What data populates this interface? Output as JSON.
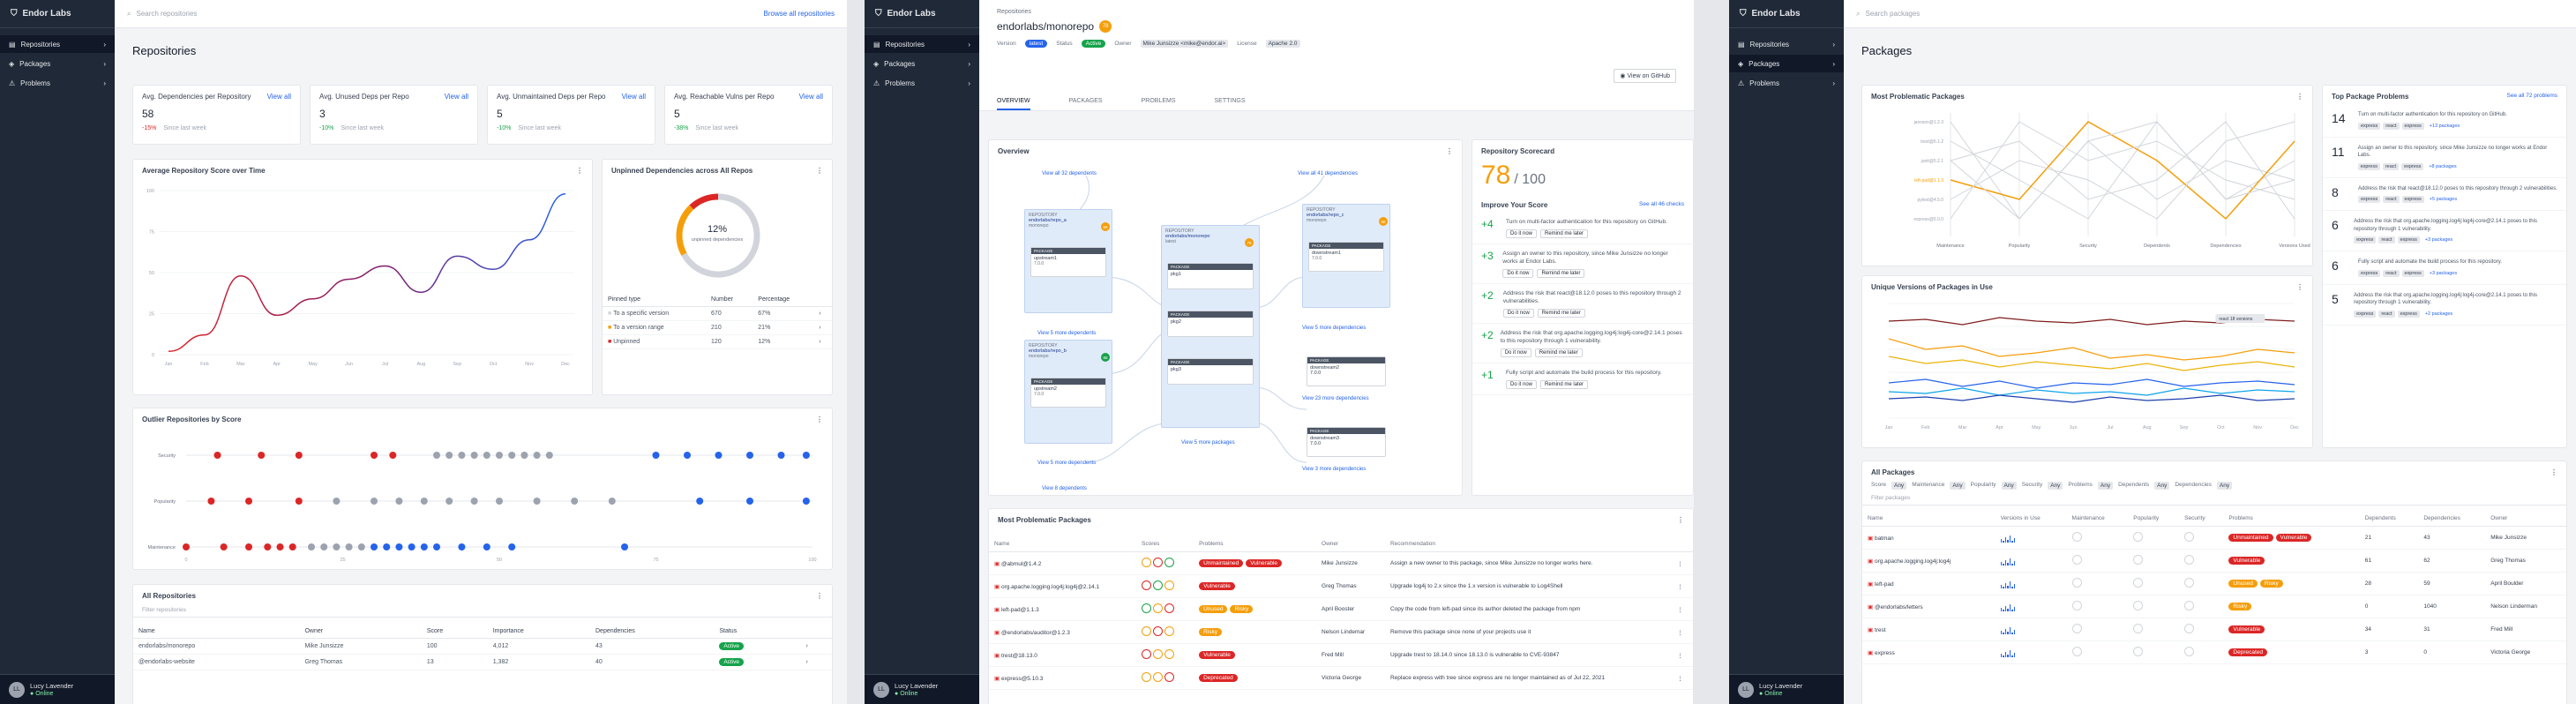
{
  "brand": "Endor Labs",
  "user": {
    "name": "Lucy Lavender",
    "status": "Online",
    "initials": "LL"
  },
  "nav": [
    "Repositories",
    "Packages",
    "Problems"
  ],
  "s1": {
    "search_placeholder": "Search repositories",
    "browse_link": "Browse all repositories",
    "title": "Repositories",
    "kpis": [
      {
        "title": "Avg. Dependencies per Repository",
        "link": "View all",
        "value": "58",
        "delta": "-15%",
        "since": "Since last week",
        "dir": "down"
      },
      {
        "title": "Avg. Unused Deps per Repo",
        "link": "View all",
        "value": "3",
        "delta": "-10%",
        "since": "Since last week",
        "dir": "up"
      },
      {
        "title": "Avg. Unmaintained Deps per Repo",
        "link": "View all",
        "value": "5",
        "delta": "-10%",
        "since": "Since last week",
        "dir": "up"
      },
      {
        "title": "Avg. Reachable Vulns per Repo",
        "link": "View all",
        "value": "5",
        "delta": "-38%",
        "since": "Since last week",
        "dir": "up"
      }
    ],
    "score_chart": {
      "title": "Average Repository Score over Time"
    },
    "unpinned": {
      "title": "Unpinned Dependencies across All Repos",
      "pct": "12%",
      "sub": "unpinned dependencies",
      "headers": [
        "Pinned type",
        "Number",
        "Percentage"
      ],
      "rows": [
        [
          "To a specific version",
          "670",
          "67%"
        ],
        [
          "To a version range",
          "210",
          "21%"
        ],
        [
          "Unpinned",
          "120",
          "12%"
        ]
      ]
    },
    "outlier": {
      "title": "Outlier Repositories by Score",
      "rows": [
        "Security",
        "Popularity",
        "Maintenance"
      ]
    },
    "all_repos": {
      "title": "All Repositories",
      "filter": "Filter repositories",
      "headers": [
        "Name",
        "Owner",
        "Score",
        "Importance",
        "Dependencies",
        "Status"
      ],
      "rows": [
        [
          "endorlabs/monorepo",
          "Mike Junsizze",
          "100",
          "4,012",
          "43",
          "Active"
        ],
        [
          "@endorlabs-website",
          "Greg Thomas",
          "13",
          "1,382",
          "40",
          "Active"
        ]
      ]
    }
  },
  "chart_data": [
    {
      "type": "line",
      "title": "Average Repository Score over Time",
      "categories": [
        "Jan",
        "Feb",
        "Mar",
        "Apr",
        "May",
        "Jun",
        "Jul",
        "Aug",
        "Sep",
        "Oct",
        "Nov",
        "Dec"
      ],
      "series": [
        {
          "values": [
            2,
            12,
            48,
            24,
            34,
            46,
            54,
            38,
            60,
            52,
            70,
            98
          ]
        }
      ],
      "ylim": [
        0,
        100
      ],
      "yticks": [
        "0",
        "25",
        "50",
        "75",
        "100"
      ]
    },
    {
      "type": "pie",
      "title": "Unpinned Dependencies across All Repos",
      "categories": [
        "To a specific version",
        "To a version range",
        "Unpinned"
      ],
      "values": [
        67,
        21,
        12
      ]
    },
    {
      "type": "scatter",
      "title": "Outlier Repositories by Score",
      "categories": [
        "Security",
        "Popularity",
        "Maintenance"
      ],
      "xticks": [
        "0",
        "25",
        "50",
        "75",
        "100"
      ],
      "xlim": [
        0,
        100
      ]
    }
  ],
  "s2": {
    "crumb": "Repositories",
    "title": "endorlabs/monorepo",
    "score": "78",
    "meta": {
      "version_label": "Version",
      "version": "latest",
      "status_label": "Status",
      "status": "Active",
      "owner_label": "Owner",
      "owner": "Mike Junsizze <mike@endor.ai>",
      "license_label": "License",
      "license": "Apache 2.0"
    },
    "github_btn": "View on GitHub",
    "tabs": [
      "OVERVIEW",
      "PACKAGES",
      "PROBLEMS",
      "SETTINGS"
    ],
    "overview_title": "Overview",
    "view_dependents": "View all 32 dependents",
    "view_deps": "View all 41 dependencies",
    "view_more_deps": "View 5 more dependents",
    "view_8": "View 8 dependents",
    "view_more_packages": "View 5 more packages",
    "view_more_deps2": "View 5 more dependencies",
    "view_23": "View 23 more dependencies",
    "view_3": "View 3 more dependencies",
    "scorecard": {
      "title": "Repository Scorecard",
      "score": "78",
      "out": "/ 100",
      "improve": "Improve Your Score",
      "see_all": "See all 46 checks",
      "items": [
        {
          "pts": "+4",
          "text": "Turn on multi-factor authentication for this repository on GitHub."
        },
        {
          "pts": "+3",
          "text": "Assign an owner to this repository, since Mike Junsizze no longer works at Endor Labs."
        },
        {
          "pts": "+2",
          "text": "Address the risk that react@18.12.0 poses to this repository through 2 vulnerabilities."
        },
        {
          "pts": "+2",
          "text": "Address the risk that org.apache.logging.log4j:log4j-core@2.14.1 poses to this repository through 1 vulnerability."
        },
        {
          "pts": "+1",
          "text": "Fully script and automate the build process for this repository."
        }
      ],
      "btn1": "Do it now",
      "btn2": "Remind me later"
    },
    "problematic": {
      "title": "Most Problematic Packages",
      "headers": [
        "Name",
        "Scores",
        "Problems",
        "Owner",
        "Recommendation"
      ],
      "rows": [
        [
          "@abmul@1.4.2",
          "Unmaintained",
          "Vulnerable",
          "Mike Junsizze",
          "Assign a new owner to this package, since Mike Junsizze no longer works here."
        ],
        [
          "org.apache.logging.log4j:log4j@2.14.1",
          "Vulnerable",
          "",
          "Greg Thomas",
          "Upgrade log4j to 2.x since the 1.x version is vulnerable to Log4Shell"
        ],
        [
          "left-pad@1.1.3",
          "Unused",
          "Risky",
          "April Booster",
          "Copy the code from left-pad since its author deleted the package from npm"
        ],
        [
          "@endorlabs/auditor@1.2.3",
          "Risky",
          "",
          "Nelson Lindemar",
          "Remove this package since none of your projects use it"
        ],
        [
          "trest@18.13.0",
          "Vulnerable",
          "",
          "Fred Mill",
          "Upgrade trest to 18.14.0 since 18.13.0 is vulnerable to CVE-93847"
        ],
        [
          "express@5.10.3",
          "Deprecated",
          "",
          "Victoria George",
          "Replace express with tree since express are no longer maintained as of Jul 22, 2021"
        ]
      ]
    }
  },
  "s3": {
    "search_placeholder": "Search packages",
    "title": "Packages",
    "mp_title": "Most Problematic Packages",
    "mp_axes": [
      "Maintenance",
      "Popularity",
      "Security",
      "Dependents",
      "Dependencies",
      "Versions Used"
    ],
    "mp_names": [
      "jansson@1.2.3",
      "trest@6.1.2",
      "junit@5.2.1",
      "left-pad@1.1.3",
      "pytest@4.5.0",
      "express@5.0.0"
    ],
    "uv_title": "Unique Versions of Packages in Use",
    "uv_tooltip": "react 18 versions",
    "uv_months": [
      "Jan",
      "Feb",
      "Mar",
      "Apr",
      "May",
      "Jun",
      "Jul",
      "Aug",
      "Sep",
      "Oct",
      "Nov",
      "Dec"
    ],
    "top_title": "Top Package Problems",
    "top_link": "See all 72 problems",
    "problems": [
      {
        "n": "14",
        "text": "Turn on multi-factor authentication for this repository on GitHub.",
        "more": "+13 packages"
      },
      {
        "n": "11",
        "text": "Assign an owner to this repository, since Mike Junsizze no longer works at Endor Labs.",
        "more": "+8 packages"
      },
      {
        "n": "8",
        "text": "Address the risk that react@18.12.0 poses to this repository through 2 vulnerabilities.",
        "more": "+5 packages"
      },
      {
        "n": "6",
        "text": "Address the risk that org.apache.logging.log4j:log4j-core@2.14.1 poses to this repository through 1 vulnerability.",
        "more": "+3 packages"
      },
      {
        "n": "6",
        "text": "Fully script and automate the build process for this repository.",
        "more": "+3 packages"
      },
      {
        "n": "5",
        "text": "Address the risk that org.apache.logging.log4j:log4j-core@2.14.1 poses to this repository through 1 vulnerability.",
        "more": "+2 packages"
      }
    ],
    "tags": [
      "express",
      "react",
      "express"
    ],
    "all_title": "All Packages",
    "filters": [
      "Score",
      "Maintenance",
      "Popularity",
      "Security",
      "Problems",
      "Dependents",
      "Dependencies"
    ],
    "filter_any": "Any",
    "filter_placeholder": "Filter packages",
    "headers": [
      "Name",
      "Versions in Use",
      "Maintenance",
      "Popularity",
      "Security",
      "Problems",
      "Dependents",
      "Dependencies",
      "Owner"
    ],
    "rows": [
      [
        "batman",
        "Unmaintained",
        "Vulnerable",
        "21",
        "43",
        "Mike Junsizze"
      ],
      [
        "org.apache.logging.log4j:log4j",
        "Vulnerable",
        "",
        "61",
        "62",
        "Greg Thomas"
      ],
      [
        "left-pad",
        "Unused",
        "Risky",
        "28",
        "59",
        "April Boulder"
      ],
      [
        "@endorlabs/letters",
        "Risky",
        "",
        "0",
        "1040",
        "Nelson Linderman"
      ],
      [
        "trest",
        "Vulnerable",
        "",
        "34",
        "31",
        "Fred Mill"
      ],
      [
        "express",
        "Deprecated",
        "",
        "3",
        "0",
        "Victoria George"
      ]
    ]
  }
}
